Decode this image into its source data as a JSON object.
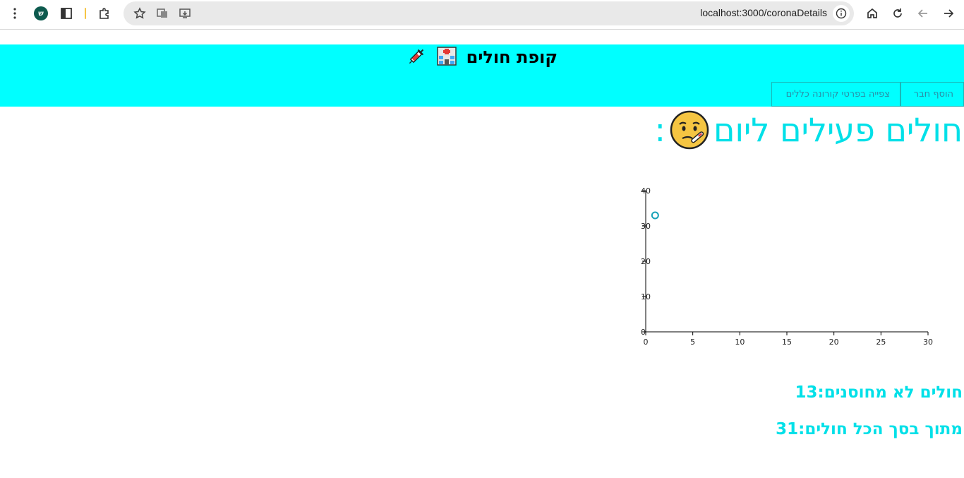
{
  "browser": {
    "url": "localhost:3000/coronaDetails",
    "profile_initial": "ש"
  },
  "header": {
    "title": "קופת חולים",
    "title_icons": [
      "hospital-icon",
      "syringe-icon"
    ],
    "nav": [
      {
        "label": "הוסף חבר"
      },
      {
        "label": "צפייה בפרטי קורונה כללים"
      }
    ]
  },
  "main": {
    "heading": "חולים פעילים ליום",
    "heading_suffix": ":",
    "heading_icon": "sick-face-icon",
    "stats": {
      "unvaccinated": "חולים לא מחוסנים:13",
      "total": "מתוך בסך הכל חולים:31"
    }
  },
  "chart_data": {
    "type": "scatter",
    "x_ticks": [
      "0",
      "5",
      "10",
      "15",
      "20",
      "25",
      "30"
    ],
    "y_ticks": [
      "0",
      "10",
      "20",
      "30",
      "40"
    ],
    "xlim": [
      0,
      30
    ],
    "ylim": [
      0,
      40
    ],
    "grid": false,
    "series": [
      {
        "points": [
          {
            "x": 1,
            "y": 33
          }
        ],
        "color": "#17a2b8"
      }
    ]
  },
  "colors": {
    "header_bg": "#00ffff",
    "accent": "#00e0e8",
    "nav_text": "#2a8ea6",
    "point": "#17a2b8"
  }
}
